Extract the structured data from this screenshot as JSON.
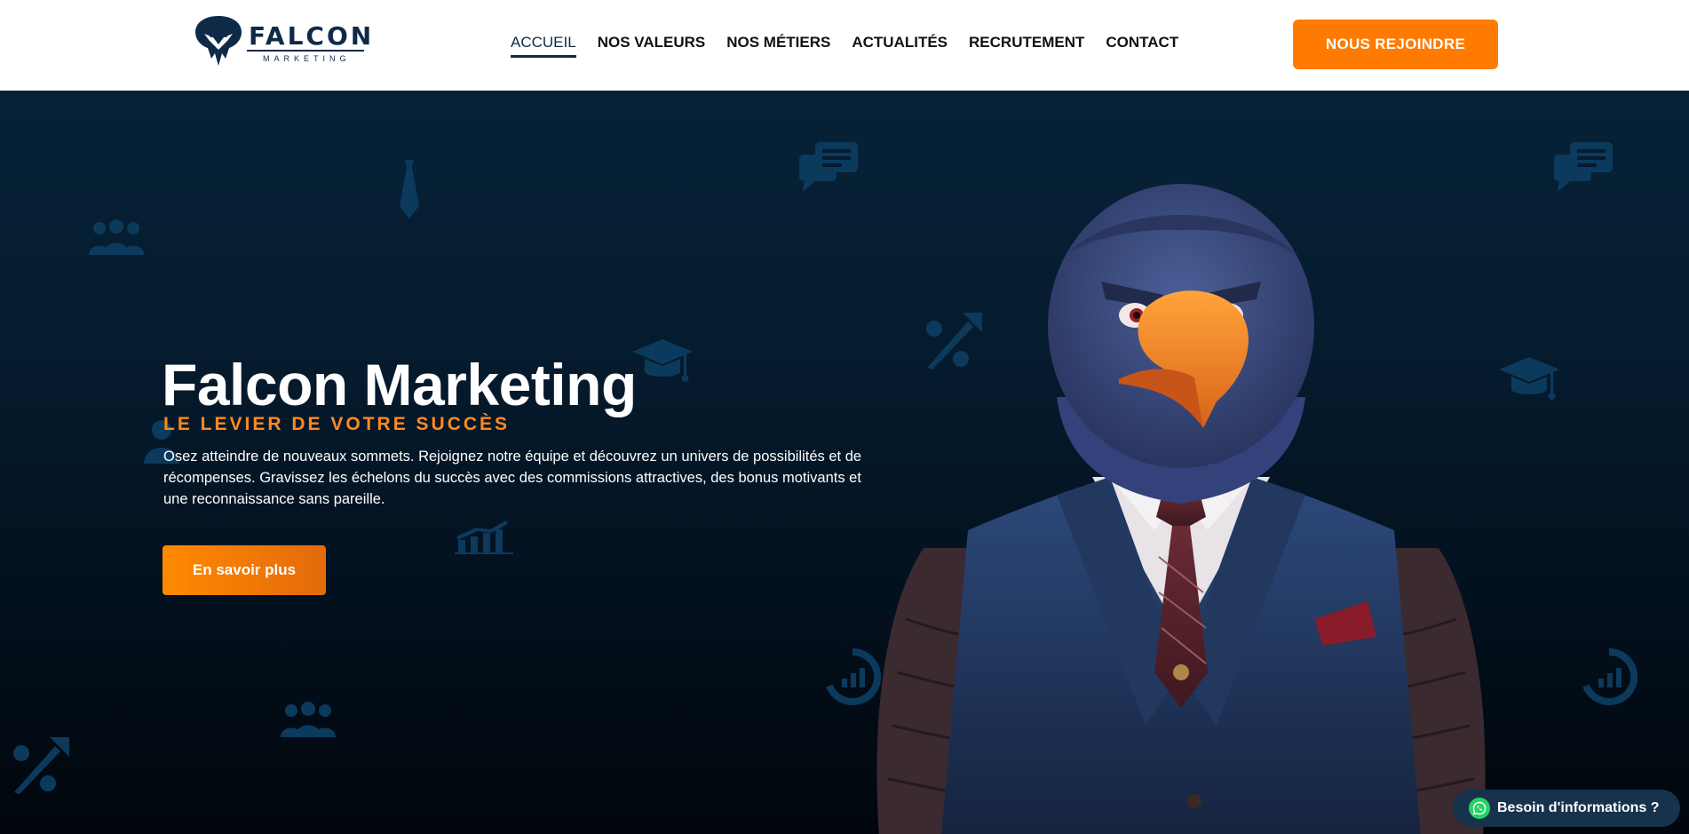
{
  "brand": {
    "name": "FALCON",
    "tagline": "MARKETING",
    "icon": "falcon-logo-icon"
  },
  "nav": {
    "items": [
      {
        "label": "ACCUEIL",
        "active": true
      },
      {
        "label": "NOS VALEURS",
        "active": false
      },
      {
        "label": "NOS MÉTIERS",
        "active": false
      },
      {
        "label": "ACTUALITÉS",
        "active": false
      },
      {
        "label": "RECRUTEMENT",
        "active": false
      },
      {
        "label": "CONTACT",
        "active": false
      }
    ],
    "cta_label": "NOUS REJOINDRE"
  },
  "hero": {
    "title": "Falcon Marketing",
    "subtitle": "LE LEVIER DE VOTRE SUCCÈS",
    "description": "Osez atteindre de nouveaux sommets. Rejoignez notre équipe et découvrez un univers de possibilités et de récompenses. Gravissez les échelons du succès avec des commissions attractives, des bonus motivants et une reconnaissance sans pareille.",
    "button_label": "En savoir plus",
    "image": "falcon-in-suit-illustration"
  },
  "whatsapp": {
    "label": "Besoin d'informations ?",
    "icon": "whatsapp-icon"
  },
  "colors": {
    "accent": "#ff7a00",
    "brand_navy": "#0e2a47",
    "hero_bg": "#051b2e",
    "icon_pattern": "#0c3a5c",
    "whatsapp_green": "#25d366"
  }
}
